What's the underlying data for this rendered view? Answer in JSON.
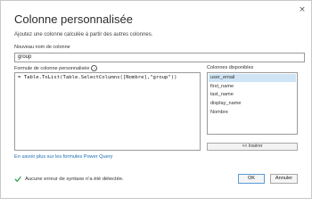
{
  "dialog": {
    "title": "Colonne personnalisée",
    "subtitle": "Ajoutez une colonne calculée à partir des autres colonnes.",
    "close_icon": "×"
  },
  "name_field": {
    "label": "Nouveau nom de colonne",
    "value": "group"
  },
  "formula": {
    "label": "Formule de colonne personnalisée",
    "info_icon": "i",
    "text": "= Table.ToList(Table.SelectColumns([Nombre],\"group\"))"
  },
  "columns": {
    "label": "Colonnes disponibles",
    "items": [
      "user_email",
      "first_name",
      "last_name",
      "display_name",
      "Nombre"
    ],
    "selected_index": 0,
    "insert_label": "<< Insérer"
  },
  "learn_link": "En savoir plus sur les formules Power Query",
  "status": {
    "text": "Aucune erreur de syntaxe n'a été détectée.",
    "color": "#2e9e4a"
  },
  "buttons": {
    "ok": "OK",
    "cancel": "Annuler"
  }
}
